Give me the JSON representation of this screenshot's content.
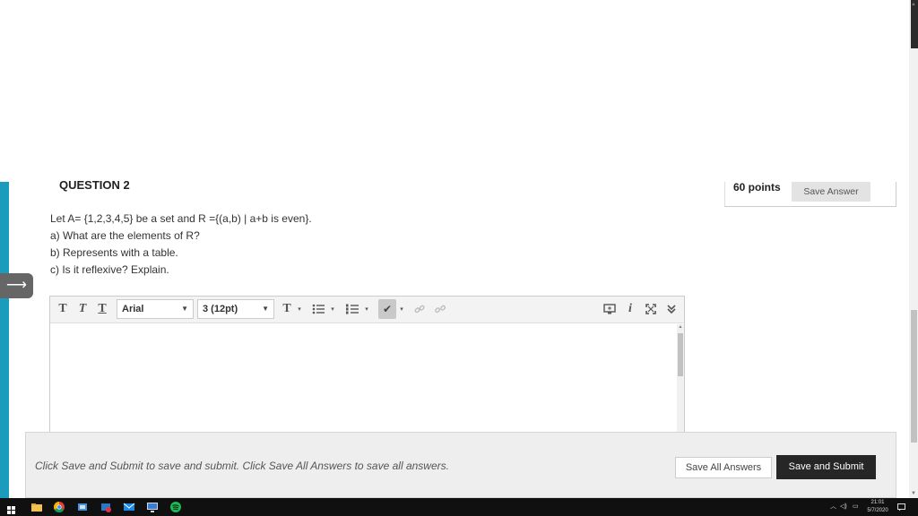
{
  "question": {
    "title": "QUESTION 2",
    "points": "60 points",
    "save_answer_label": "Save Answer",
    "lines": [
      "Let A= {1,2,3,4,5} be a set and R ={(a,b) | a+b is even}.",
      "a) What are the elements of R?",
      "b) Represents with a table.",
      "c) Is it reflexive? Explain."
    ]
  },
  "editor": {
    "font_select": "Arial",
    "size_select": "3 (12pt)",
    "toolbar_icons": [
      "bold-text-icon",
      "italic-text-icon",
      "underline-text-icon",
      "text-color-icon",
      "bullet-list-icon",
      "numbered-list-icon",
      "spellcheck-icon",
      "link-icon",
      "unlink-icon",
      "preview-icon",
      "info-icon",
      "fullscreen-icon",
      "expand-toolbar-icon"
    ],
    "value": ""
  },
  "footer": {
    "instruction": "Click Save and Submit to save and submit. Click Save All Answers to save all answers.",
    "save_all_label": "Save All Answers",
    "save_submit_label": "Save and Submit"
  },
  "taskbar": {
    "time": "21:01",
    "date": "5/7/2020"
  },
  "colors": {
    "accent_teal": "#1c9cbd",
    "submit_button": "#262626",
    "footer_bg": "#eeeeee"
  }
}
